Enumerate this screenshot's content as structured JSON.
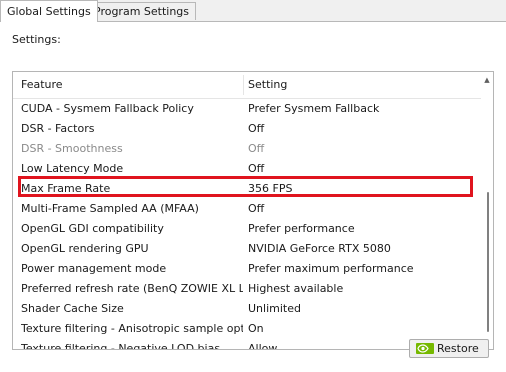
{
  "tabs": [
    {
      "label": "Global Settings",
      "active": true
    },
    {
      "label": "Program Settings",
      "active": false
    }
  ],
  "settings_label": "Settings:",
  "columns": {
    "feature": "Feature",
    "setting": "Setting"
  },
  "rows": [
    {
      "feature": "CUDA - Sysmem Fallback Policy",
      "setting": "Prefer Sysmem Fallback",
      "disabled": false
    },
    {
      "feature": "DSR - Factors",
      "setting": "Off",
      "disabled": false
    },
    {
      "feature": "DSR - Smoothness",
      "setting": "Off",
      "disabled": true
    },
    {
      "feature": "Low Latency Mode",
      "setting": "Off",
      "disabled": false
    },
    {
      "feature": "Max Frame Rate",
      "setting": "356 FPS",
      "disabled": false,
      "highlighted": true
    },
    {
      "feature": "Multi-Frame Sampled AA (MFAA)",
      "setting": "Off",
      "disabled": false
    },
    {
      "feature": "OpenGL GDI compatibility",
      "setting": "Prefer performance",
      "disabled": false
    },
    {
      "feature": "OpenGL rendering GPU",
      "setting": "NVIDIA GeForce RTX 5080",
      "disabled": false
    },
    {
      "feature": "Power management mode",
      "setting": "Prefer maximum performance",
      "disabled": false
    },
    {
      "feature": "Preferred refresh rate (BenQ ZOWIE XL L...",
      "setting": "Highest available",
      "disabled": false
    },
    {
      "feature": "Shader Cache Size",
      "setting": "Unlimited",
      "disabled": false
    },
    {
      "feature": "Texture filtering - Anisotropic sample opti...",
      "setting": "On",
      "disabled": false
    },
    {
      "feature": "Texture filtering - Negative LOD bias",
      "setting": "Allow",
      "disabled": false
    }
  ],
  "restore_label": "Restore",
  "colors": {
    "highlight": "#e0141e",
    "nvidia_green": "#76b900"
  },
  "icons": {
    "restore": "nvidia-logo-icon",
    "scroll_up": "scroll-up-arrow-icon"
  }
}
